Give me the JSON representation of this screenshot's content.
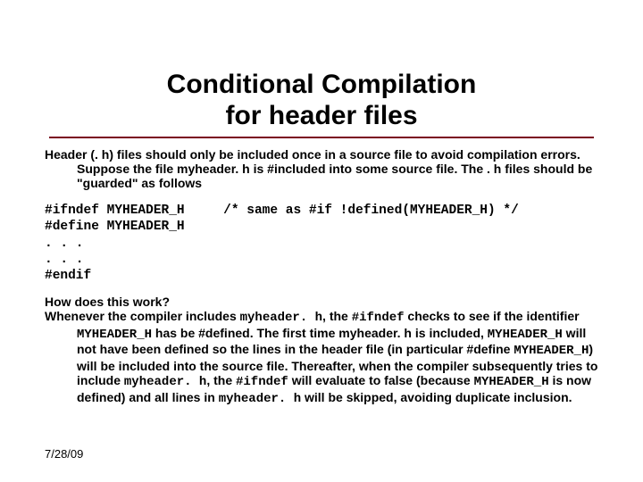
{
  "title_line1": "Conditional Compilation",
  "title_line2": "for header files",
  "para1": "Header (. h) files should only be included once in a source file to avoid compilation errors.  Suppose the file myheader. h is #included into some source file.  The . h files should be \"guarded\" as follows",
  "code": {
    "l1a": "#ifndef MYHEADER_H",
    "l1b": "     /* same as #if !defined(MYHEADER_H) */",
    "l2": "#define MYHEADER_H",
    "l3": ". . .",
    "l4": ". . .",
    "l5": "#endif"
  },
  "para2": {
    "q": "How does this work?",
    "t1": "Whenever the compiler includes ",
    "m1": "myheader. h",
    "t2": ", the ",
    "m2": "#ifndef",
    "t3": " checks to see if the identifier ",
    "m3": "MYHEADER_H",
    "t4": " has be #defined.  The first time myheader. h is included, ",
    "m4": "MYHEADER_H",
    "t5": " will not have been defined so the lines  in the header file (in particular #define ",
    "m5": "MYHEADER_H",
    "t6": ") will be included into the source file.  Thereafter, when the compiler subsequently tries to include ",
    "m6": "myheader. h",
    "t7": ", the ",
    "m7": "#ifndef",
    "t8": " will evaluate to false (because ",
    "m8": "MYHEADER_H",
    "t9": " is now defined) and all lines in ",
    "m9": "myheader. h",
    "t10": " will be skipped, avoiding duplicate inclusion."
  },
  "date": "7/28/09"
}
